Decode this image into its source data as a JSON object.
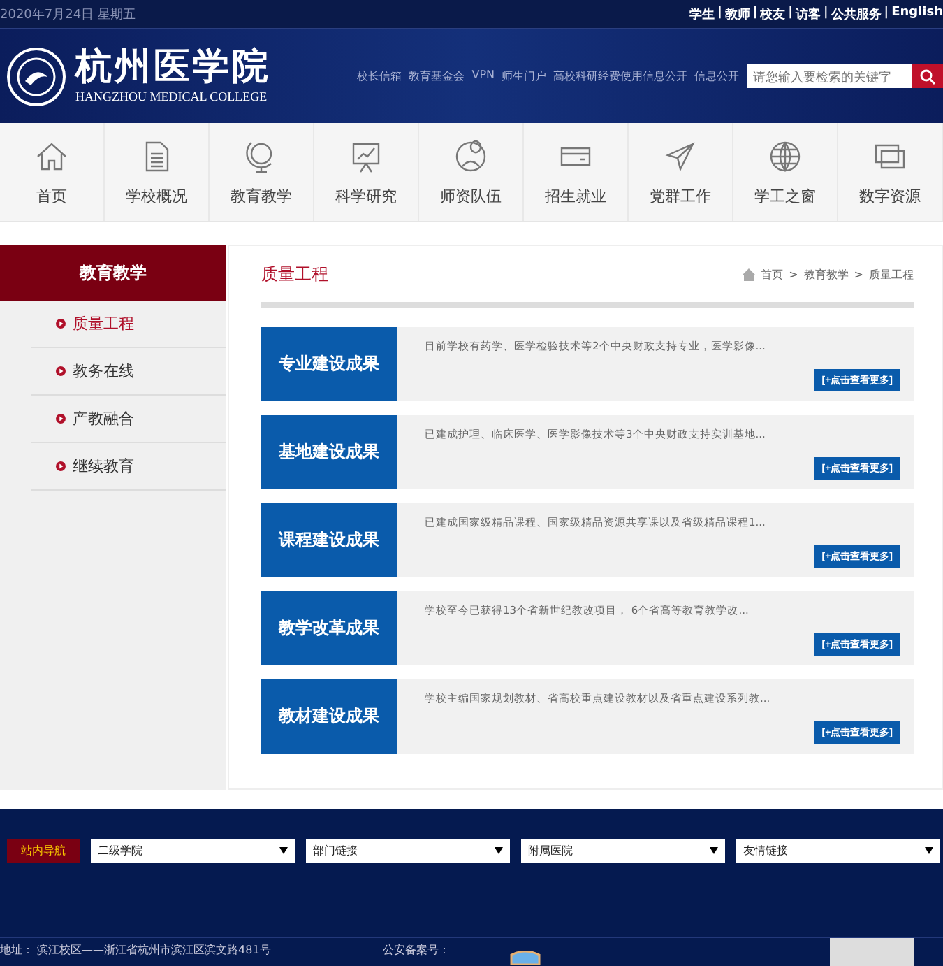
{
  "top_bar": {
    "date": "2020年7月24日 星期五",
    "separator": "|",
    "links": [
      "学生",
      "教师",
      "校友",
      "访客",
      "公共服务",
      "English"
    ]
  },
  "header": {
    "logo": {
      "name": "杭州医学院",
      "english": "HANGZHOU MEDICAL COLLEGE"
    },
    "links": [
      "校长信箱",
      "教育基金会",
      "VPN",
      "师生门户",
      "高校科研经费使用信息公开",
      "信息公开"
    ],
    "search": {
      "placeholder": "请您输入要检索的关键字"
    }
  },
  "nav": [
    {
      "label": "首页"
    },
    {
      "label": "学校概况"
    },
    {
      "label": "教育教学"
    },
    {
      "label": "科学研究"
    },
    {
      "label": "师资队伍"
    },
    {
      "label": "招生就业"
    },
    {
      "label": "党群工作"
    },
    {
      "label": "学工之窗"
    },
    {
      "label": "数字资源"
    }
  ],
  "sidebar": {
    "title": "教育教学",
    "items": [
      {
        "label": "质量工程",
        "selected": true
      },
      {
        "label": "教务在线",
        "selected": false
      },
      {
        "label": "产教融合",
        "selected": false
      },
      {
        "label": "继续教育",
        "selected": false
      }
    ]
  },
  "content": {
    "title": "质量工程",
    "breadcrumb": [
      "首页",
      "教育教学",
      "质量工程"
    ],
    "breadcrumb_separator": ">",
    "cards": [
      {
        "title": "专业建设成果",
        "summary": "目前学校有药学、医学检验技术等2个中央财政支持专业，医学影像...",
        "more": "[+点击查看更多]"
      },
      {
        "title": "基地建设成果",
        "summary": "已建成护理、临床医学、医学影像技术等3个中央财政支持实训基地...",
        "more": "[+点击查看更多]"
      },
      {
        "title": "课程建设成果",
        "summary": "已建成国家级精品课程、国家级精品资源共享课以及省级精品课程1...",
        "more": "[+点击查看更多]"
      },
      {
        "title": "教学改革成果",
        "summary": "学校至今已获得13个省新世纪教改项目， 6个省高等教育教学改...",
        "more": "[+点击查看更多]"
      },
      {
        "title": "教材建设成果",
        "summary": "学校主编国家规划教材、省高校重点建设教材以及省重点建设系列教...",
        "more": "[+点击查看更多]"
      }
    ]
  },
  "footer": {
    "nav_label": "站内导航",
    "selects": [
      {
        "value": "二级学院"
      },
      {
        "value": "部门链接"
      },
      {
        "value": "附属医院"
      },
      {
        "value": "友情链接"
      }
    ],
    "address": "地址：  滨江校区——浙江省杭州市滨江区滨文路481号",
    "police_record": "公安备案号："
  }
}
